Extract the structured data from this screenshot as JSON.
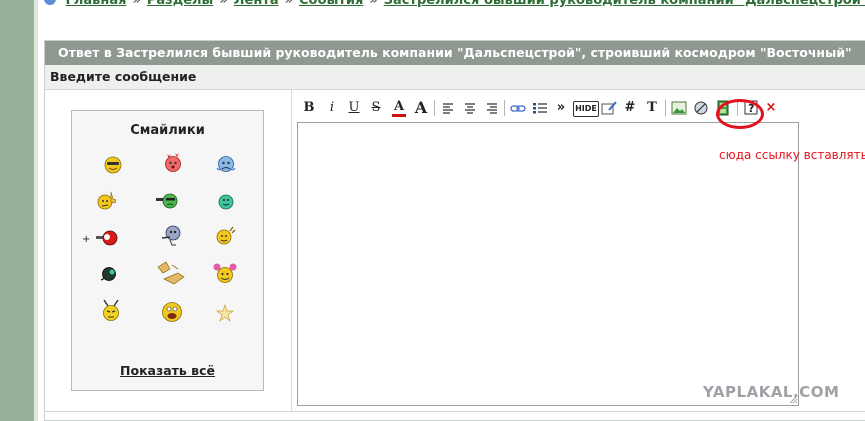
{
  "breadcrumb": {
    "items": [
      "Главная",
      "Разделы",
      "Лента",
      "События",
      "Застрелился бывший руководитель компании \"Дальспецстрой\", строивший"
    ],
    "separator": "»"
  },
  "panel": {
    "title": "Ответ в Застрелился бывший руководитель компании \"Дальспецстрой\", строивший космодром \"Восточный\"",
    "subheader": "Введите сообщение"
  },
  "smilies": {
    "title": "Смайлики",
    "show_all": "Показать всё"
  },
  "toolbar": {
    "bold": "B",
    "italic": "i",
    "underline": "U",
    "strike": "S",
    "font_color": "A",
    "font_size": "A",
    "more": "»",
    "hide": "HIDE",
    "hash": "#",
    "tex": "T",
    "close": "×"
  },
  "editor": {
    "value": ""
  },
  "annotation": {
    "text": "сюда ссылку вставлять",
    "color": "#e2131c"
  },
  "watermark": "YAPLAKAL.COM",
  "colors": {
    "title_bar": "#8f9992",
    "accent_red": "#e2131c",
    "link_green": "#2f6f37"
  }
}
